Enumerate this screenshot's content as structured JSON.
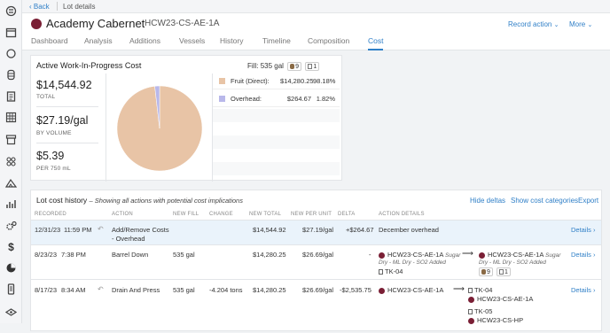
{
  "rail": {
    "icons": [
      "wine-bottle-icon",
      "calendar-icon",
      "circle-icon",
      "barrel-icon",
      "clipboard-icon",
      "grid-icon",
      "box-icon",
      "cellar-icon",
      "vineyard-icon",
      "chart-icon",
      "gears-icon",
      "dollar-icon",
      "pie-icon",
      "phone-icon",
      "layers-icon"
    ]
  },
  "topbar": {
    "back_label": "Back",
    "crumb": "Lot details"
  },
  "header": {
    "lot_name": "Academy Cabernet",
    "lot_code": "HCW23-CS-AE-1A",
    "record_action": "Record action",
    "more": "More",
    "lot_color": "#7a1f35",
    "tabs": [
      "Dashboard",
      "Analysis",
      "Additions",
      "Vessels",
      "History",
      "Timeline",
      "Composition",
      "Cost"
    ],
    "active_tab": "Cost"
  },
  "wip": {
    "title": "Active Work-In-Progress Cost",
    "fill_label": "Fill:",
    "fill_value": "535 gal",
    "barrel_count": "9",
    "tank_count": "1",
    "total_value": "$14,544.92",
    "total_label": "TOTAL",
    "per_gal_value": "$27.19/gal",
    "per_gal_label": "BY VOLUME",
    "per_750_value": "$5.39",
    "per_750_label": "PER 750 mL",
    "legend": [
      {
        "name": "Fruit (Direct):",
        "amount": "$14,280.25",
        "pct": "98.18%",
        "color": "#e8c4a6",
        "fraction": 0.9818
      },
      {
        "name": "Overhead:",
        "amount": "$264.67",
        "pct": "1.82%",
        "color": "#b9b8ea",
        "fraction": 0.0182
      }
    ]
  },
  "history": {
    "title": "Lot cost history",
    "subtitle": "– Showing all actions with potential cost implications",
    "hide_deltas": "Hide deltas",
    "show_categories": "Show cost categories",
    "export": "Export",
    "columns": [
      "RECORDED",
      "ACTION",
      "NEW FILL",
      "CHANGE",
      "NEW TOTAL",
      "NEW PER UNIT",
      "DELTA",
      "ACTION DETAILS"
    ],
    "rows": [
      {
        "date": "12/31/23",
        "time": "11:59 PM",
        "action1": "Add/Remove Costs",
        "action2": "- Overhead",
        "fill": "",
        "change": "",
        "total": "$14,544.92",
        "per_unit": "$27.19/gal",
        "delta": "+$264.67",
        "detail": "December overhead",
        "link": "Details"
      },
      {
        "date": "8/23/23",
        "time": "7:38 PM",
        "action1": "Barrel Down",
        "action2": "",
        "fill": "535 gal",
        "change": "",
        "total": "$14,280.25",
        "per_unit": "$26.69/gal",
        "delta": "-",
        "from_lot": "HCW23-CS-AE-1A",
        "from_note": "Sugar",
        "from_note2": "Dry - ML Dry - SO2 Added",
        "from_vessel": "TK-04",
        "to_lot": "HCW23-CS-AE-1A",
        "to_note": "Sugar",
        "to_note2": "Dry - ML Dry - SO2 Added",
        "to_barrels": "9",
        "to_tanks": "1",
        "link": "Details"
      },
      {
        "date": "8/17/23",
        "time": "8:34 AM",
        "action1": "Drain And Press",
        "action2": "",
        "fill": "535 gal",
        "change": "-4.204 tons",
        "total": "$14,280.25",
        "per_unit": "$26.69/gal",
        "delta": "-$2,535.75",
        "from_lot": "HCW23-CS-AE-1A",
        "to_vessel_1": "TK-04",
        "to_lot_1": "HCW23-CS-AE-1A",
        "to_vessel_2": "TK-05",
        "to_lot_2": "HCW23-CS-HP",
        "link": "Details"
      }
    ]
  }
}
